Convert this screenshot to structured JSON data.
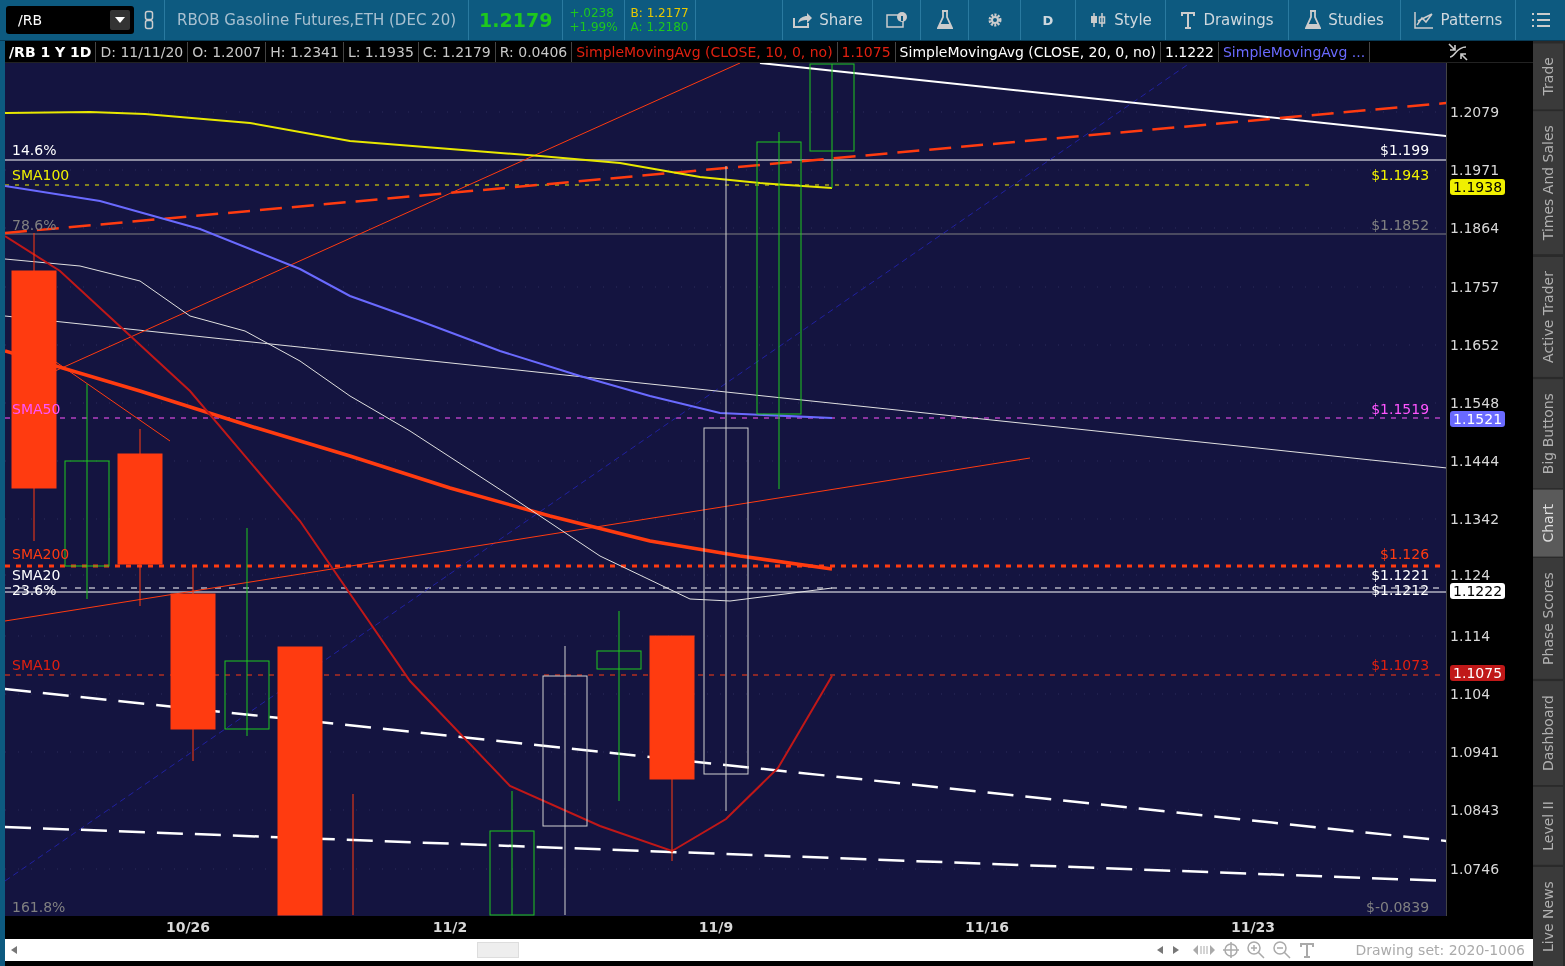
{
  "toolbar": {
    "symbol": "/RB",
    "description": "RBOB Gasoline Futures,ETH (DEC 20)",
    "last": "1.2179",
    "change": "+.0238",
    "change_pct": "+1.99%",
    "bid": "B: 1.2177",
    "ask": "A: 1.2180",
    "buttons": [
      {
        "kind": "share",
        "label": "Share"
      },
      {
        "kind": "info"
      },
      {
        "kind": "flask"
      },
      {
        "kind": "gear"
      },
      {
        "kind": "text",
        "label": "D"
      },
      {
        "kind": "style",
        "label": "Style"
      },
      {
        "kind": "drawings",
        "label": "Drawings"
      },
      {
        "kind": "studies",
        "label": "Studies"
      },
      {
        "kind": "patterns",
        "label": "Patterns"
      },
      {
        "kind": "menu"
      }
    ]
  },
  "info_bar": [
    {
      "text": "/RB 1 Y 1D",
      "kind": "title"
    },
    {
      "text": "D: 11/11/20",
      "kind": "field"
    },
    {
      "text": "O: 1.2007",
      "kind": "field"
    },
    {
      "text": "H: 1.2341",
      "kind": "field"
    },
    {
      "text": "L: 1.1935",
      "kind": "field"
    },
    {
      "text": "C: 1.2179",
      "kind": "field"
    },
    {
      "text": "R: 0.0406",
      "kind": "field"
    },
    {
      "text": "SimpleMovingAvg (CLOSE, 10, 0, no)",
      "kind": "sma10"
    },
    {
      "text": "1.1075",
      "kind": "sma10"
    },
    {
      "text": "SimpleMovingAvg (CLOSE, 20, 0, no)",
      "kind": "sma20"
    },
    {
      "text": "1.1222",
      "kind": "sma20"
    },
    {
      "text": "SimpleMovingAvg ...",
      "kind": "sma50"
    }
  ],
  "chart": {
    "left_labels": [
      {
        "text": "14.6%",
        "kind": "fib"
      },
      {
        "text": "SMA100",
        "kind": "sma100"
      },
      {
        "text": "78.6%",
        "kind": "fib_dim"
      },
      {
        "text": "SMA50",
        "kind": "sma50"
      },
      {
        "text": "SMA200",
        "kind": "sma200"
      },
      {
        "text": "SMA20",
        "kind": "sma20"
      },
      {
        "text": "23.6%",
        "kind": "fib"
      },
      {
        "text": "SMA10",
        "kind": "sma10"
      },
      {
        "text": "161.8%",
        "kind": "fib_dim"
      }
    ],
    "right_labels": [
      {
        "text": "$1.199",
        "kind": "fib"
      },
      {
        "text": "$1.1943",
        "kind": "sma100"
      },
      {
        "text": "$1.1852",
        "kind": "fib_dim"
      },
      {
        "text": "$1.1519",
        "kind": "sma50"
      },
      {
        "text": "$1.126",
        "kind": "sma200"
      },
      {
        "text": "$1.1221",
        "kind": "sma20"
      },
      {
        "text": "$1.1212",
        "kind": "fib"
      },
      {
        "text": "$1.1073",
        "kind": "sma10"
      },
      {
        "text": "$-0.0839",
        "kind": "fib_dim"
      }
    ],
    "price_ticks": [
      "1.2079",
      "1.1971",
      "1.1864",
      "1.1757",
      "1.1652",
      "1.1548",
      "1.1444",
      "1.1342",
      "1.124",
      "1.114",
      "1.104",
      "1.0941",
      "1.0843",
      "1.0746"
    ],
    "price_badges": [
      {
        "text": "1.1938",
        "kind": "sma100"
      },
      {
        "text": "1.1521",
        "kind": "sma50"
      },
      {
        "text": "1.1222",
        "kind": "sma20"
      },
      {
        "text": "1.1075",
        "kind": "sma10"
      }
    ],
    "date_ticks": [
      "10/26",
      "11/2",
      "11/9",
      "11/16",
      "11/23"
    ]
  },
  "drawing_set": "Drawing set: 2020-1006",
  "side_tabs": [
    {
      "label": "Trade",
      "selected": false
    },
    {
      "label": "Times And Sales",
      "selected": false
    },
    {
      "label": "Active Trader",
      "selected": false
    },
    {
      "label": "Big Buttons",
      "selected": false
    },
    {
      "label": "Chart",
      "selected": true
    },
    {
      "label": "Phase Scores",
      "selected": false
    },
    {
      "label": "Dashboard",
      "selected": false
    },
    {
      "label": "Level II",
      "selected": false
    },
    {
      "label": "Live News",
      "selected": false
    }
  ]
}
